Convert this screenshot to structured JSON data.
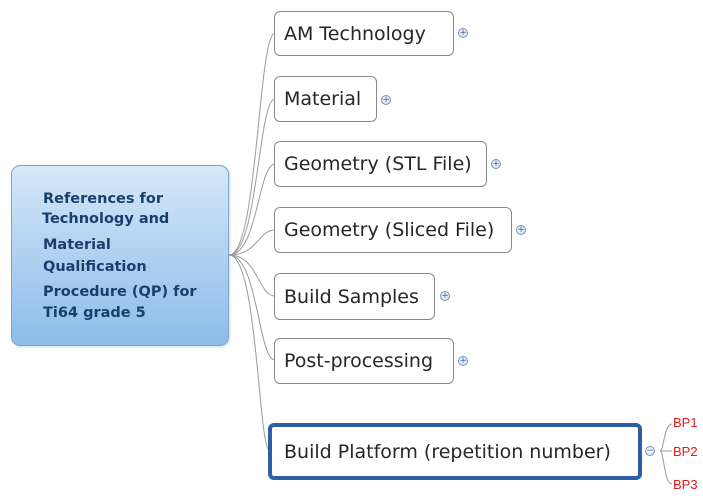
{
  "root": {
    "lines": [
      "References for",
      "Technology and",
      "Material",
      "Qualification",
      "Procedure (QP) for",
      "Ti64 grade 5"
    ]
  },
  "topics": [
    {
      "label": "AM Technology",
      "expander": "+"
    },
    {
      "label": "Material",
      "expander": "+"
    },
    {
      "label": "Geometry (STL File)",
      "expander": "+"
    },
    {
      "label": "Geometry (Sliced File)",
      "expander": "+"
    },
    {
      "label": "Build Samples",
      "expander": "+"
    },
    {
      "label": "Post-processing",
      "expander": "+"
    },
    {
      "label": "Build Platform (repetition number)",
      "expander": "−"
    }
  ],
  "subtopics": [
    "BP1",
    "BP2",
    "BP3"
  ],
  "colors": {
    "root_fill": "#a9cdef",
    "selection_border": "#2d5fa8",
    "subtopic_text": "#e01b1b",
    "connector": "#9a9a9a"
  }
}
